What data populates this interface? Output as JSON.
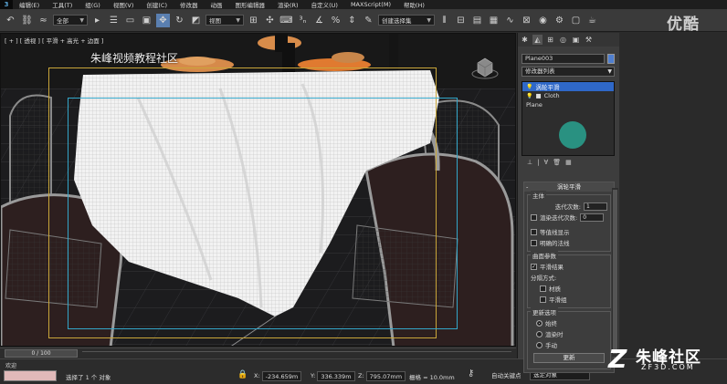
{
  "menu": {
    "items": [
      "编辑(E)",
      "工具(T)",
      "组(G)",
      "视图(V)",
      "创建(C)",
      "修改器",
      "动画",
      "图形编辑器",
      "渲染(R)",
      "自定义(U)",
      "MAXScript(M)",
      "帮助(H)"
    ]
  },
  "toolbar": {
    "selection_filter": "全部",
    "ref_coord": "视图",
    "named_selection": "创建选择集"
  },
  "watermark": {
    "top_logo": "优酷"
  },
  "viewport": {
    "label": "[ + ] [ 透视 ] [ 平滑 + 高光 + 边面 ]",
    "title": "朱峰视频教程社区"
  },
  "timeline": {
    "frame": "0 / 100"
  },
  "status": {
    "message": "选择了 1 个 对象",
    "x_label": "X:",
    "x_value": "-234.659m",
    "y_label": "Y:",
    "y_value": "336.339m",
    "z_label": "Z:",
    "z_value": "795.07mm",
    "grid": "栅格 = 10.0mm",
    "autokey": "自动关键点",
    "autokey_select": "选定对象",
    "mini_listener": "欢迎"
  },
  "panel": {
    "object_name": "Plane003",
    "object_color": "#4f7fd0",
    "modifier_list": "修改器列表",
    "stack": [
      {
        "label": "涡轮平滑",
        "selected": true
      },
      {
        "label": "Cloth",
        "selected": false
      },
      {
        "label": "Plane",
        "selected": false
      }
    ],
    "rollout_title": "涡轮平滑",
    "main": {
      "title": "主体",
      "iterations_label": "迭代次数:",
      "iterations_value": "1",
      "render_iters_label": "渲染迭代次数:",
      "render_iters_value": "0",
      "isoline_label": "等值线显示",
      "explicit_normals_label": "明确的法线"
    },
    "surface": {
      "title": "曲面参数",
      "smooth_result_label": "平滑结果",
      "separate_by_label": "分隔方式:",
      "materials_label": "材质",
      "smoothing_groups_label": "平滑组"
    },
    "update": {
      "title": "更新选项",
      "always_label": "始终",
      "when_rendering_label": "渲染时",
      "manually_label": "手动",
      "update_button": "更新"
    }
  },
  "brand": {
    "name": "朱峰社区",
    "url": "ZF3D.COM",
    "mark": "Z"
  }
}
